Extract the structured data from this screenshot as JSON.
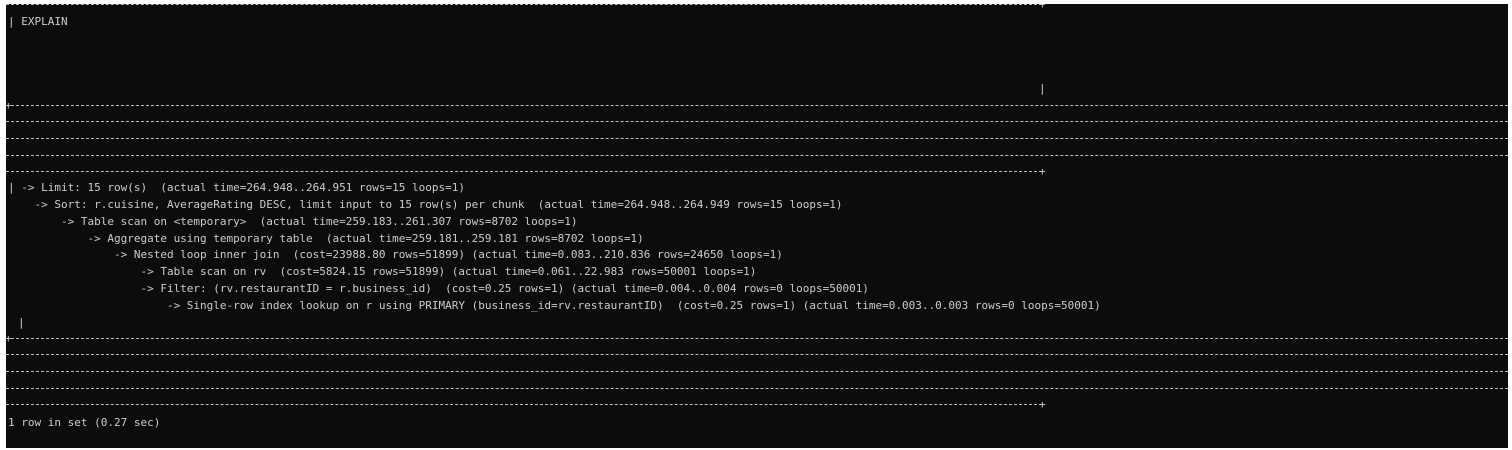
{
  "terminal": {
    "header_text": "| EXPLAIN",
    "plan_lines": [
      "| -> Limit: 15 row(s)  (actual time=264.948..264.951 rows=15 loops=1)",
      "    -> Sort: r.cuisine, AverageRating DESC, limit input to 15 row(s) per chunk  (actual time=264.948..264.949 rows=15 loops=1)",
      "        -> Table scan on <temporary>  (actual time=259.183..261.307 rows=8702 loops=1)",
      "            -> Aggregate using temporary table  (actual time=259.181..259.181 rows=8702 loops=1)",
      "                -> Nested loop inner join  (cost=23988.80 rows=51899) (actual time=0.083..210.836 rows=24650 loops=1)",
      "                    -> Table scan on rv  (cost=5824.15 rows=51899) (actual time=0.061..22.983 rows=50001 loops=1)",
      "                    -> Filter: (rv.restaurantID = r.business_id)  (cost=0.25 rows=1) (actual time=0.004..0.004 rows=0 loops=50001)",
      "                        -> Single-row index lookup on r using PRIMARY (business_id=rv.restaurantID)  (cost=0.25 rows=1) (actual time=0.003..0.003 rows=0 loops=50001)"
    ],
    "pipe_char": "|",
    "plus_char": "+",
    "footer_text": "1 row in set (0.27 sec)"
  },
  "colors": {
    "background": "#0c0c0c",
    "text": "#cccccc"
  }
}
